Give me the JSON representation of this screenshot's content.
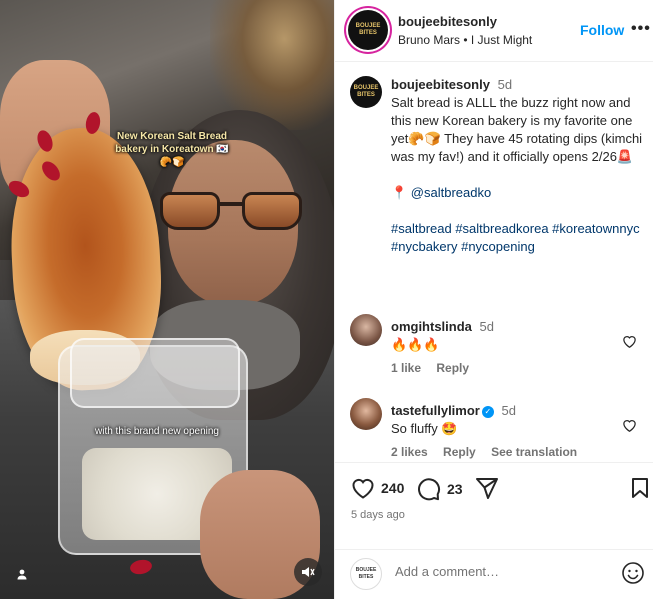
{
  "media": {
    "caption_overlay_1": "New Korean Salt Bread bakery in Koreatown 🇰🇷🥐🍞",
    "caption_overlay_2": "with this brand new opening"
  },
  "header": {
    "username": "boujeebitesonly",
    "music": "Bruno Mars • I Just Might",
    "follow_label": "Follow",
    "more_label": "•••",
    "avatar_text": "BOUJEE BITES"
  },
  "caption": {
    "username": "boujeebitesonly",
    "time": "5d",
    "body": "Salt bread is ALLL the buzz right now and this new Korean bakery is my favorite one yet🥐🍞 They have 45 rotating dips (kimchi was my fav!) and it officially opens 2/26🚨",
    "location": "📍 @saltbreadko",
    "hashtags": "#saltbread #saltbreadkorea #koreatownnyc #nycbakery #nycopening"
  },
  "comments": [
    {
      "username": "omgihtslinda",
      "time": "5d",
      "text": "🔥🔥🔥",
      "likes": "1 like",
      "reply": "Reply"
    },
    {
      "username": "tastefullylimor",
      "time": "5d",
      "text": "So fluffy 🤩",
      "likes": "2 likes",
      "reply": "Reply",
      "translate": "See translation"
    }
  ],
  "actions": {
    "like_count": "240",
    "comment_count": "23",
    "posted_ago": "5 days ago"
  },
  "add_comment": {
    "placeholder": "Add a comment…"
  },
  "colors": {
    "link": "#00376b",
    "follow": "#0095f6",
    "muted": "#737373"
  }
}
